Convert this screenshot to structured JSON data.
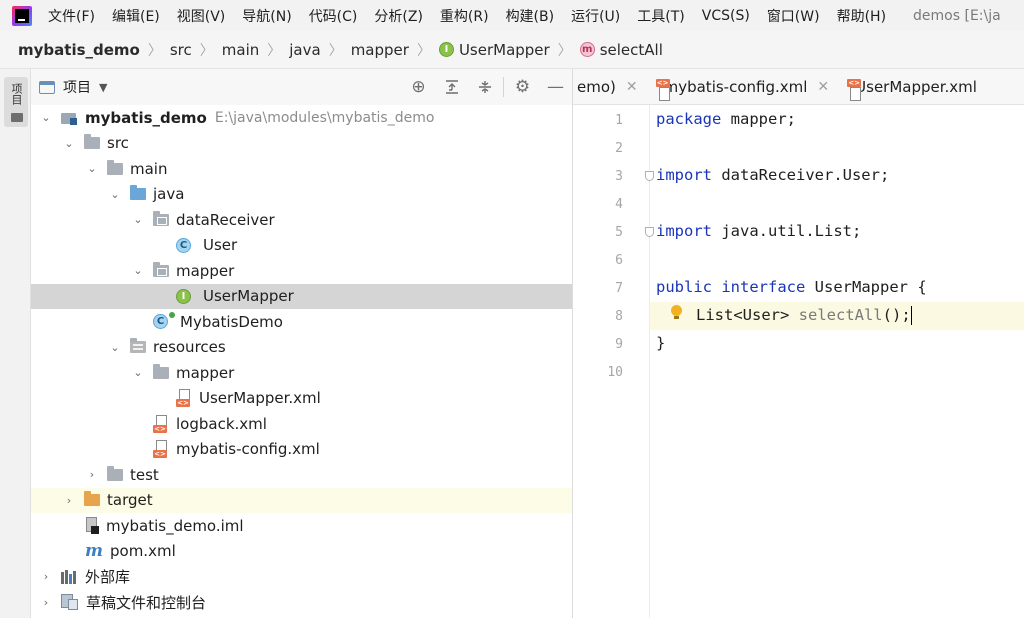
{
  "menubar": {
    "items": [
      "文件(F)",
      "编辑(E)",
      "视图(V)",
      "导航(N)",
      "代码(C)",
      "分析(Z)",
      "重构(R)",
      "构建(B)",
      "运行(U)",
      "工具(T)",
      "VCS(S)",
      "窗口(W)",
      "帮助(H)"
    ],
    "window_title": "demos [E:\\ja"
  },
  "breadcrumb": {
    "project": "mybatis_demo",
    "items": [
      "src",
      "main",
      "java",
      "mapper"
    ],
    "class": "UserMapper",
    "method": "selectAll",
    "class_badge": "I",
    "method_badge": "m"
  },
  "left_strip": {
    "tab_label": "项目"
  },
  "project_panel": {
    "title": "项目",
    "tree": {
      "root": {
        "label": "mybatis_demo",
        "path": "E:\\java\\modules\\mybatis_demo"
      },
      "src": "src",
      "main": "main",
      "java": "java",
      "dataReceiver": "dataReceiver",
      "user": "User",
      "mapper_pkg": "mapper",
      "user_mapper": "UserMapper",
      "mybatis_demo_class": "MybatisDemo",
      "resources": "resources",
      "res_mapper": "mapper",
      "user_mapper_xml": "UserMapper.xml",
      "logback_xml": "logback.xml",
      "mybatis_config_xml": "mybatis-config.xml",
      "test": "test",
      "target": "target",
      "iml": "mybatis_demo.iml",
      "pom": "pom.xml",
      "external_libs": "外部库",
      "scratches": "草稿文件和控制台"
    }
  },
  "editor": {
    "tabs": [
      {
        "label": "emo)"
      },
      {
        "label": "mybatis-config.xml"
      },
      {
        "label": "UserMapper.xml"
      }
    ],
    "line_numbers": [
      "1",
      "2",
      "3",
      "4",
      "5",
      "6",
      "7",
      "8",
      "9",
      "10"
    ],
    "code": {
      "l1_kw": "package",
      "l1_rest": " mapper;",
      "l3_kw": "import",
      "l3_rest": " dataReceiver.User;",
      "l5_kw": "import",
      "l5_rest": " java.util.List;",
      "l7_kw1": "public",
      "l7_kw2": "interface",
      "l7_rest": " UserMapper {",
      "l8_type": "List<User> ",
      "l8_method": "selectAll",
      "l8_end": "();",
      "l9": "}"
    }
  },
  "colors": {
    "keyword": "#1a36b8",
    "current_line": "#fbf9e1",
    "selected_row": "#d5d5d5",
    "excluded_row": "#fdfce6"
  }
}
